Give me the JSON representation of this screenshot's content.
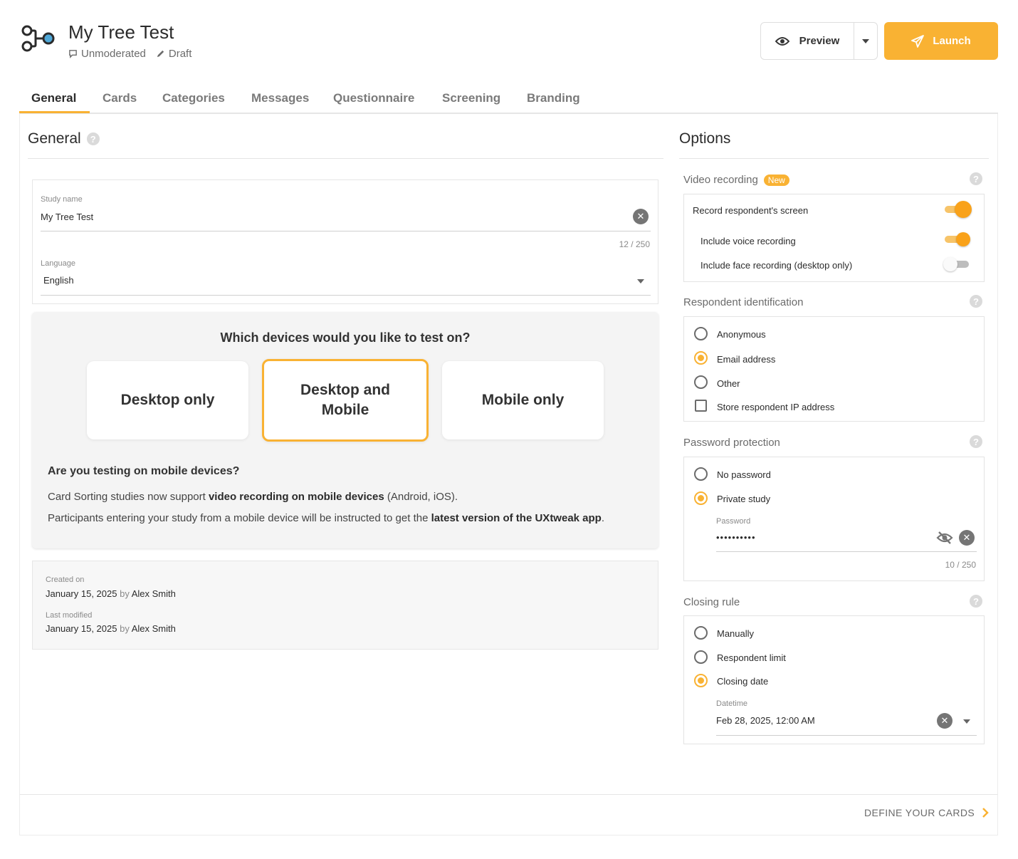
{
  "header": {
    "title": "My Tree Test",
    "mode": "Unmoderated",
    "status": "Draft",
    "preview_label": "Preview",
    "launch_label": "Launch"
  },
  "colors": {
    "accent": "#f9b233",
    "text": "#2b2b2b",
    "muted": "#7a7a7a"
  },
  "icons": {
    "logo": "tree-logo-icon",
    "mode": "chat-bubble-icon",
    "status": "pencil-icon",
    "preview": "eye-icon",
    "launch": "paper-plane-icon"
  },
  "tabs": [
    {
      "label": "General",
      "active": true
    },
    {
      "label": "Cards"
    },
    {
      "label": "Categories"
    },
    {
      "label": "Messages"
    },
    {
      "label": "Questionnaire"
    },
    {
      "label": "Screening"
    },
    {
      "label": "Branding"
    }
  ],
  "general": {
    "title": "General",
    "help": "?",
    "study_name": {
      "label": "Study name",
      "value": "My Tree Test",
      "counter": "12 / 250"
    },
    "language": {
      "label": "Language",
      "value": "English"
    },
    "devices": {
      "question": "Which devices would you like to test on?",
      "options": [
        {
          "label": "Desktop only",
          "selected": false
        },
        {
          "label": "Desktop and Mobile",
          "line1": "Desktop and",
          "line2": "Mobile",
          "selected": true
        },
        {
          "label": "Mobile only",
          "selected": false
        }
      ],
      "mobile_heading": "Are you testing on mobile devices?",
      "mobile_p1_pre": "Card Sorting studies now support ",
      "mobile_p1_bold": "video recording on mobile devices",
      "mobile_p1_post": " (Android, iOS).",
      "mobile_p2_pre": "Participants entering your study from a mobile device will be instructed to get the ",
      "mobile_p2_bold": "latest version of the UXtweak app",
      "mobile_p2_post": "."
    },
    "meta": {
      "created_label": "Created on",
      "created_date": "January 15, 2025",
      "created_by_word": "by",
      "created_user": "Alex Smith",
      "modified_label": "Last modified",
      "modified_date": "January 15, 2025",
      "modified_by_word": "by",
      "modified_user": "Alex Smith"
    }
  },
  "options": {
    "title": "Options",
    "video": {
      "title": "Video recording",
      "badge": "New",
      "record_screen": {
        "label": "Record respondent's screen",
        "on": true
      },
      "voice": {
        "label": "Include voice recording",
        "on": true
      },
      "face": {
        "label": "Include face recording (desktop only)",
        "on": false
      }
    },
    "identification": {
      "title": "Respondent identification",
      "options": [
        {
          "label": "Anonymous",
          "selected": false
        },
        {
          "label": "Email address",
          "selected": true
        },
        {
          "label": "Other",
          "selected": false
        }
      ],
      "store_ip": {
        "label": "Store respondent IP address",
        "checked": false
      }
    },
    "password": {
      "title": "Password protection",
      "options": [
        {
          "label": "No password",
          "selected": false
        },
        {
          "label": "Private study",
          "selected": true
        }
      ],
      "field_label": "Password",
      "value": "••••••••••",
      "counter": "10 / 250"
    },
    "closing": {
      "title": "Closing rule",
      "options": [
        {
          "label": "Manually",
          "selected": false
        },
        {
          "label": "Respondent limit",
          "selected": false
        },
        {
          "label": "Closing date",
          "selected": true
        }
      ],
      "datetime_label": "Datetime",
      "datetime_value": "Feb 28, 2025, 12:00 AM"
    }
  },
  "footer": {
    "next_label": "DEFINE YOUR CARDS"
  }
}
